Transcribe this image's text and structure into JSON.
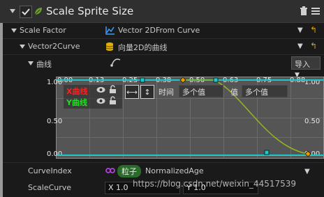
{
  "header": {
    "title": "Scale Sprite Size",
    "title_icon": "leaf-icon",
    "delete_icon": "trash-icon",
    "menu_icon": "menu-icon"
  },
  "rows": {
    "scale_factor": {
      "label": "Scale Factor",
      "value": "Vector 2DFrom Curve",
      "icon": "curve-icon"
    },
    "vector2curve": {
      "label": "Vector2Curve",
      "value": "向量2D的曲线",
      "icon": "database-icon"
    },
    "curve": {
      "label": "曲线",
      "import_label": "导入"
    },
    "curve_index": {
      "label": "CurveIndex",
      "badge": "粒子",
      "value": "NormalizedAge"
    },
    "scale_curve": {
      "label": "ScaleCurve",
      "x_value": "X 1.0",
      "y_value": "Y 1.0"
    }
  },
  "curve_editor": {
    "x_ticks": [
      "0.00",
      "0.13",
      "0.25",
      "0.38",
      "0.50",
      "0.63",
      "0.75",
      "0.88"
    ],
    "y_left_labels": [
      "1.00",
      "0.50",
      "0.00"
    ],
    "y_right_labels": [
      "1.00",
      "0.50",
      "0.00"
    ],
    "legend": {
      "x_label": "X曲线",
      "y_label": "Y曲线",
      "x_color": "#ff2020",
      "y_color": "#20e020"
    },
    "time_label": "时间",
    "time_value": "多个值",
    "value_label": "值",
    "value_value": "多个值",
    "curve_colors": {
      "x_curve": "#90b820",
      "y_curve": "#20c8c8",
      "key": "#e8a000"
    }
  },
  "watermark": "https://blog.csdn.net/weixin_44517539",
  "colors": {
    "background": "#1a1a1a",
    "header": "#2f2f2f",
    "accent_yellow": "#d8a400"
  }
}
